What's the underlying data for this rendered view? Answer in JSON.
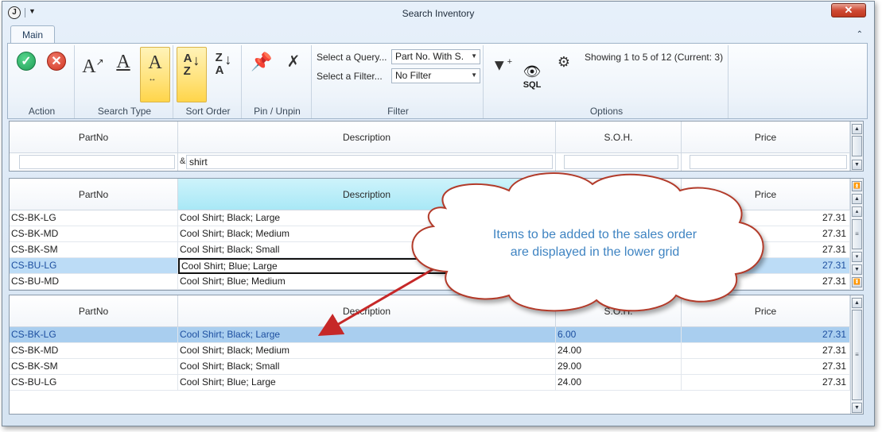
{
  "window": {
    "title": "Search Inventory"
  },
  "ribbon": {
    "tab": "Main",
    "groups": {
      "action": "Action",
      "search_type": "Search Type",
      "sort_order": "Sort Order",
      "pin_unpin": "Pin / Unpin",
      "filter": "Filter",
      "options": "Options"
    },
    "select_query_label": "Select a Query...",
    "select_query_value": "Part No. With S.",
    "select_filter_label": "Select a Filter...",
    "select_filter_value": "No Filter",
    "status": "Showing 1 to 5 of 12 (Current: 3)",
    "sql_label": "SQL"
  },
  "columns": [
    "PartNo",
    "Description",
    "S.O.H.",
    "Price"
  ],
  "search_grid": {
    "filter_operator": "&",
    "filter_value": "shirt"
  },
  "results_grid": {
    "rows": [
      {
        "part": "CS-BK-LG",
        "desc": "Cool Shirt; Black; Large",
        "soh": "",
        "price": "27.31"
      },
      {
        "part": "CS-BK-MD",
        "desc": "Cool Shirt; Black; Medium",
        "soh": "",
        "price": "27.31"
      },
      {
        "part": "CS-BK-SM",
        "desc": "Cool Shirt; Black; Small",
        "soh": "",
        "price": "27.31"
      },
      {
        "part": "CS-BU-LG",
        "desc": "Cool Shirt; Blue; Large",
        "soh": "",
        "price": "27.31"
      },
      {
        "part": "CS-BU-MD",
        "desc": "Cool Shirt; Blue; Medium",
        "soh": "",
        "price": "27.31"
      }
    ]
  },
  "order_grid": {
    "rows": [
      {
        "part": "CS-BK-LG",
        "desc": "Cool Shirt; Black; Large",
        "soh": "6.00",
        "price": "27.31"
      },
      {
        "part": "CS-BK-MD",
        "desc": "Cool Shirt; Black; Medium",
        "soh": "24.00",
        "price": "27.31"
      },
      {
        "part": "CS-BK-SM",
        "desc": "Cool Shirt; Black; Small",
        "soh": "29.00",
        "price": "27.31"
      },
      {
        "part": "CS-BU-LG",
        "desc": "Cool Shirt; Blue; Large",
        "soh": "24.00",
        "price": "27.31"
      }
    ]
  },
  "callout": {
    "line1": "Items to be added to the sales order",
    "line2": "are displayed in the lower grid"
  },
  "colors": {
    "accent_yellow": "#ffe27a",
    "selection_blue": "#a9ceef",
    "callout_text": "#3f84c2",
    "arrow_red": "#c62828"
  }
}
